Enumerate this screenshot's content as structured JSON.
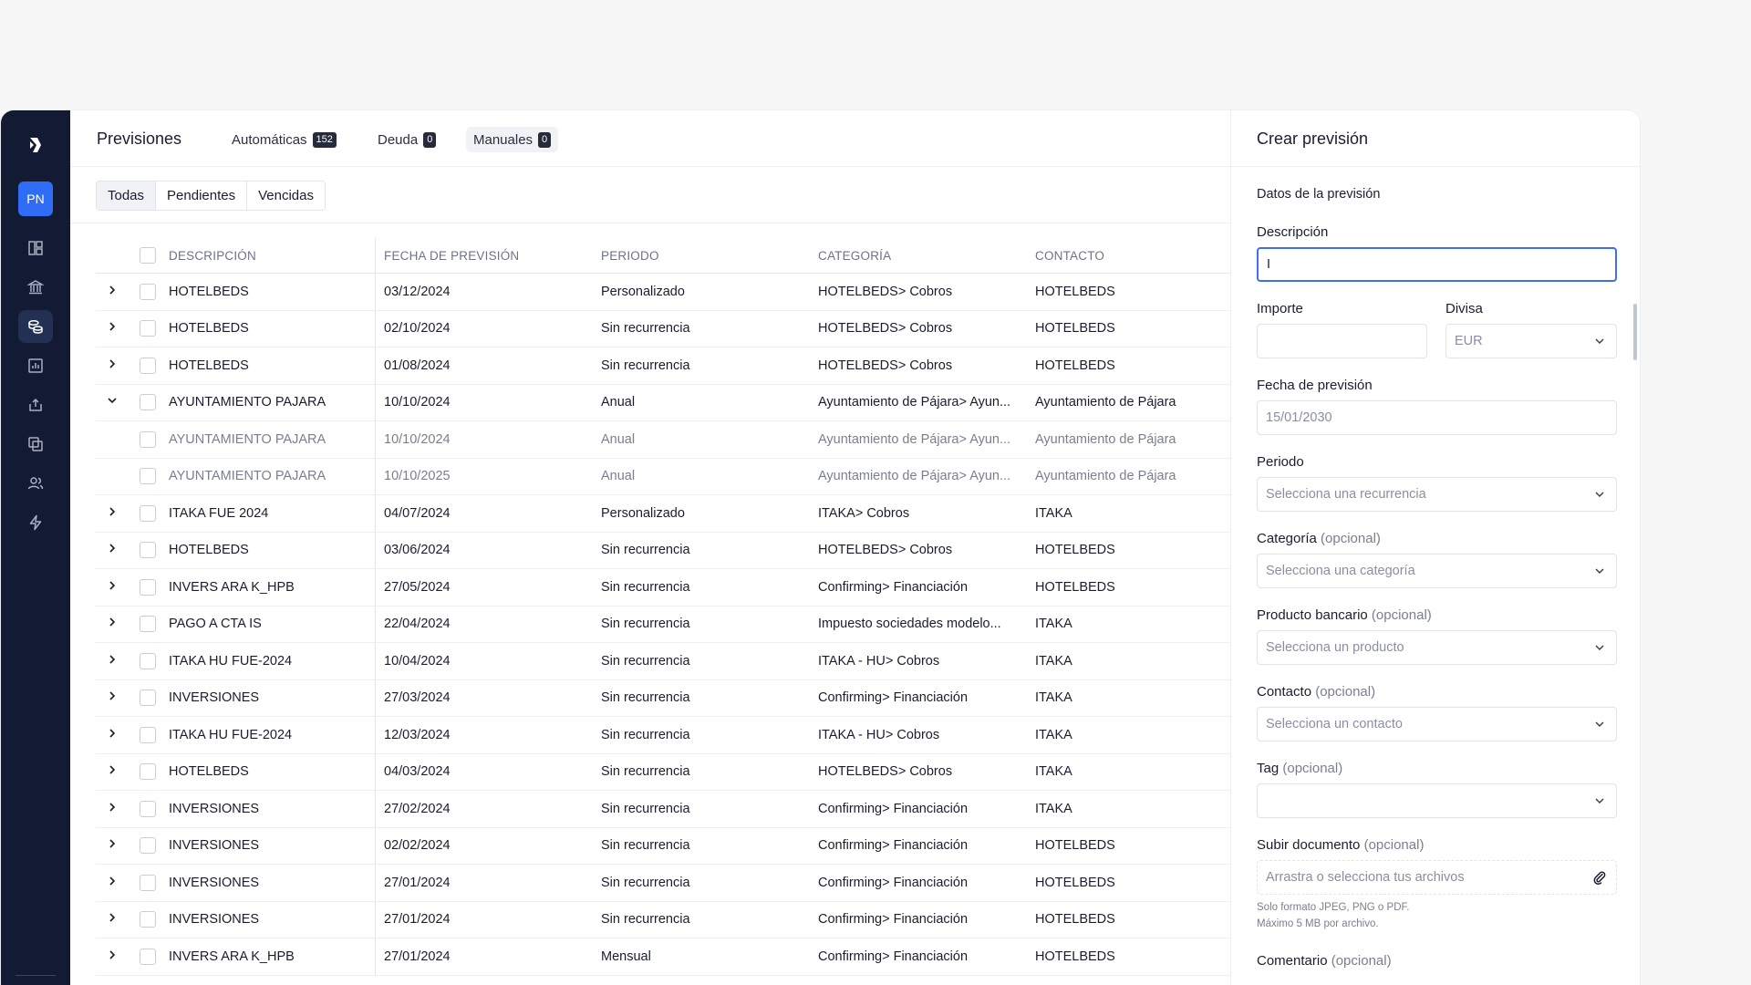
{
  "user": {
    "initials": "PN"
  },
  "header": {
    "title": "Previsiones",
    "tabs": [
      {
        "label": "Automáticas",
        "count": "152"
      },
      {
        "label": "Deuda",
        "count": "0"
      },
      {
        "label": "Manuales",
        "count": "0"
      }
    ]
  },
  "filters": [
    "Todas",
    "Pendientes",
    "Vencidas"
  ],
  "table": {
    "columns": [
      "DESCRIPCIÓN",
      "FECHA DE PREVISIÓN",
      "PERIODO",
      "CATEGORÍA",
      "CONTACTO"
    ],
    "rows": [
      {
        "desc": "HOTELBEDS",
        "date": "03/12/2024",
        "period": "Personalizado",
        "cat": "HOTELBEDS> Cobros",
        "contact": "HOTELBEDS"
      },
      {
        "desc": "HOTELBEDS",
        "date": "02/10/2024",
        "period": "Sin recurrencia",
        "cat": "HOTELBEDS> Cobros",
        "contact": "HOTELBEDS"
      },
      {
        "desc": "HOTELBEDS",
        "date": "01/08/2024",
        "period": "Sin recurrencia",
        "cat": "HOTELBEDS> Cobros",
        "contact": "HOTELBEDS"
      },
      {
        "desc": "AYUNTAMIENTO PAJARA",
        "date": "10/10/2024",
        "period": "Anual",
        "cat": "Ayuntamiento de Pájara> Ayun...",
        "contact": "Ayuntamiento de Pájara"
      },
      {
        "desc": "AYUNTAMIENTO PAJARA",
        "date": "10/10/2024",
        "period": "Anual",
        "cat": "Ayuntamiento de Pájara> Ayun...",
        "contact": "Ayuntamiento de Pájara"
      },
      {
        "desc": "AYUNTAMIENTO PAJARA",
        "date": "10/10/2025",
        "period": "Anual",
        "cat": "Ayuntamiento de Pájara> Ayun...",
        "contact": "Ayuntamiento de Pájara"
      },
      {
        "desc": "ITAKA FUE 2024",
        "date": "04/07/2024",
        "period": "Personalizado",
        "cat": "ITAKA> Cobros",
        "contact": "ITAKA"
      },
      {
        "desc": "HOTELBEDS",
        "date": "03/06/2024",
        "period": "Sin recurrencia",
        "cat": "HOTELBEDS> Cobros",
        "contact": "HOTELBEDS"
      },
      {
        "desc": "INVERS ARA K_HPB",
        "date": "27/05/2024",
        "period": "Sin recurrencia",
        "cat": "Confirming> Financiación",
        "contact": "HOTELBEDS"
      },
      {
        "desc": "PAGO A CTA IS",
        "date": "22/04/2024",
        "period": "Sin recurrencia",
        "cat": "Impuesto sociedades modelo...",
        "contact": "ITAKA"
      },
      {
        "desc": "ITAKA HU FUE-2024",
        "date": "10/04/2024",
        "period": "Sin recurrencia",
        "cat": "ITAKA - HU> Cobros",
        "contact": "ITAKA"
      },
      {
        "desc": "INVERSIONES",
        "date": "27/03/2024",
        "period": "Sin recurrencia",
        "cat": "Confirming> Financiación",
        "contact": "ITAKA"
      },
      {
        "desc": "ITAKA HU FUE-2024",
        "date": "12/03/2024",
        "period": "Sin recurrencia",
        "cat": "ITAKA - HU> Cobros",
        "contact": "ITAKA"
      },
      {
        "desc": "HOTELBEDS",
        "date": "04/03/2024",
        "period": "Sin recurrencia",
        "cat": "HOTELBEDS> Cobros",
        "contact": "ITAKA"
      },
      {
        "desc": "INVERSIONES",
        "date": "27/02/2024",
        "period": "Sin recurrencia",
        "cat": "Confirming> Financiación",
        "contact": "ITAKA"
      },
      {
        "desc": "INVERSIONES",
        "date": "02/02/2024",
        "period": "Sin recurrencia",
        "cat": "Confirming> Financiación",
        "contact": "HOTELBEDS"
      },
      {
        "desc": "INVERSIONES",
        "date": "27/01/2024",
        "period": "Sin recurrencia",
        "cat": "Confirming> Financiación",
        "contact": "HOTELBEDS"
      },
      {
        "desc": "INVERSIONES",
        "date": "27/01/2024",
        "period": "Sin recurrencia",
        "cat": "Confirming> Financiación",
        "contact": "HOTELBEDS"
      },
      {
        "desc": "INVERS ARA K_HPB",
        "date": "27/01/2024",
        "period": "Mensual",
        "cat": "Confirming> Financiación",
        "contact": "HOTELBEDS"
      }
    ]
  },
  "panel": {
    "title": "Crear previsión",
    "section": "Datos de la previsión",
    "optional": "(opcional)",
    "descripcion": {
      "label": "Descripción",
      "value": "I"
    },
    "importe": {
      "label": "Importe",
      "value": ""
    },
    "divisa": {
      "label": "Divisa",
      "value": "EUR"
    },
    "fecha": {
      "label": "Fecha de previsión",
      "placeholder": "15/01/2030"
    },
    "periodo": {
      "label": "Periodo",
      "placeholder": "Selecciona una recurrencia"
    },
    "categoria": {
      "label": "Categoría",
      "placeholder": "Selecciona una categoría"
    },
    "producto": {
      "label": "Producto bancario",
      "placeholder": "Selecciona un producto"
    },
    "contacto": {
      "label": "Contacto",
      "placeholder": "Selecciona un contacto"
    },
    "tag": {
      "label": "Tag",
      "placeholder": ""
    },
    "documento": {
      "label": "Subir documento",
      "placeholder": "Arrastra o selecciona tus archivos",
      "help1": "Solo formato JPEG, PNG o PDF.",
      "help2": "Máximo 5 MB por archivo."
    },
    "comentario": {
      "label": "Comentario"
    }
  }
}
